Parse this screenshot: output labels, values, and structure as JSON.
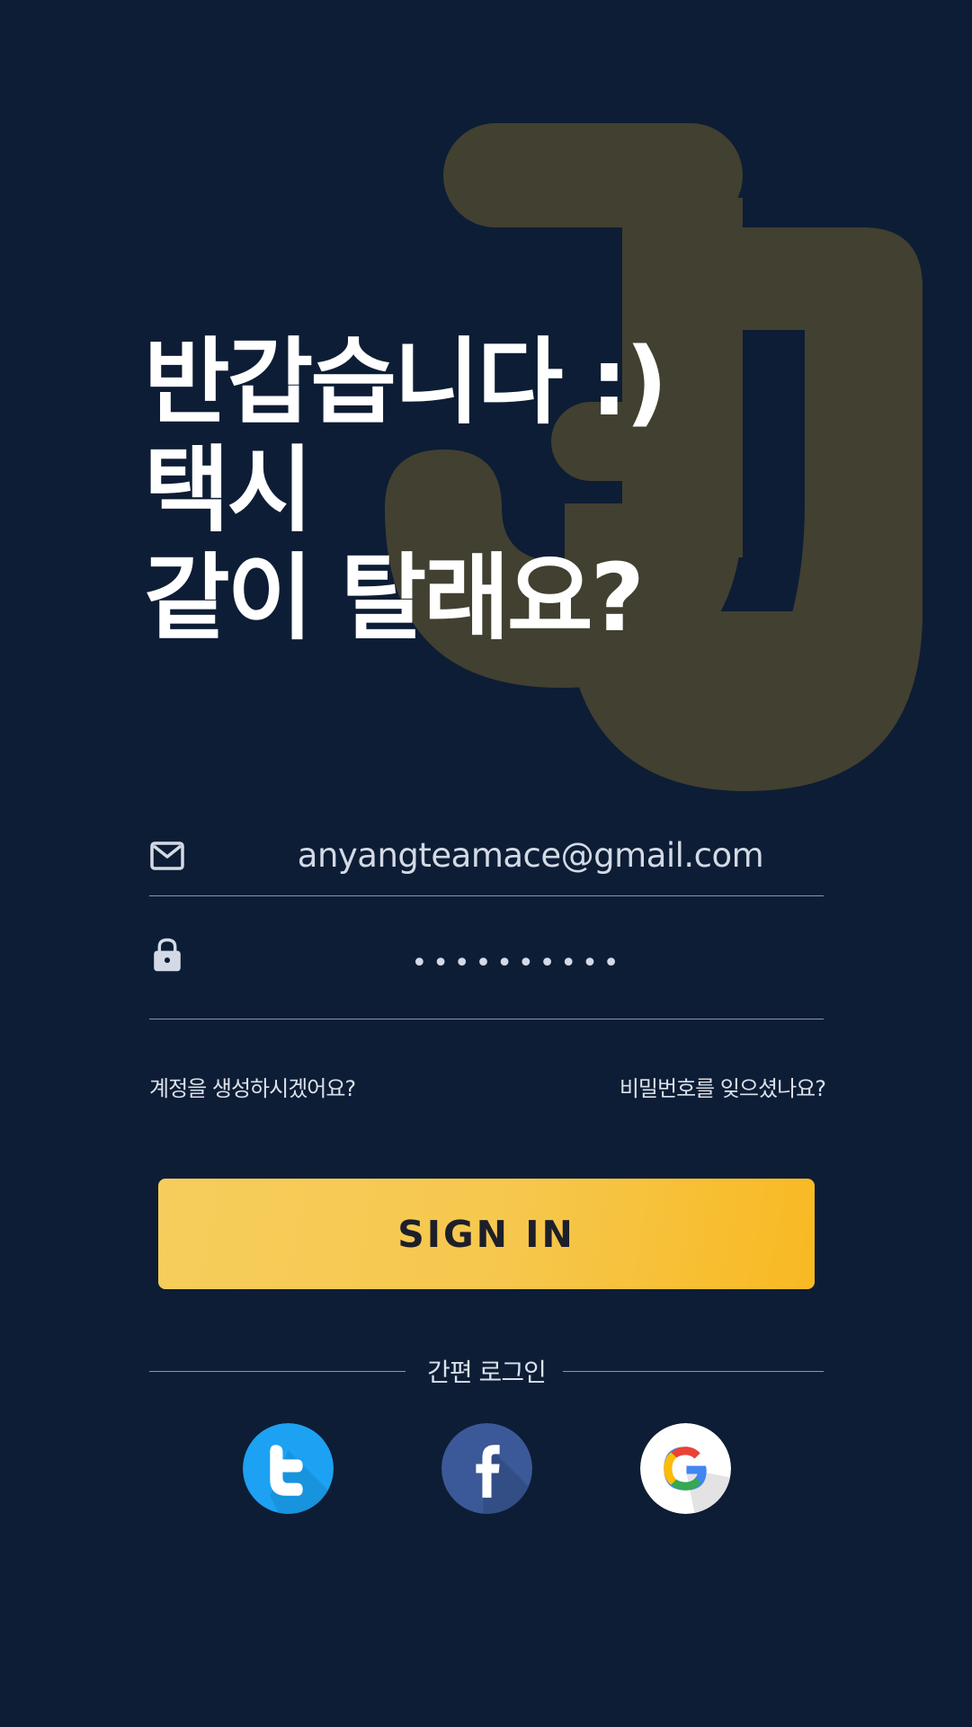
{
  "greeting": {
    "line1": "반갑습니다 :)",
    "line2": "택시",
    "line3": "같이 탈래요?"
  },
  "login_form": {
    "email_value": "anyangteamace@gmail.com",
    "email_icon": "mail-icon",
    "password_value": "••••••••••",
    "password_icon": "lock-icon"
  },
  "links": {
    "create_account": "계정을 생성하시겠어요?",
    "forgot_password": "비밀번호를 잊으셨나요?"
  },
  "signin_button": {
    "label": "SIGN IN"
  },
  "social_login": {
    "label": "간편 로그인",
    "providers": [
      "twitter",
      "facebook",
      "google"
    ]
  },
  "colors": {
    "background": "#0d1d35",
    "accent": "#f7c548",
    "logo_overlay": "#4a4530",
    "twitter": "#1da1f2",
    "facebook": "#3b5998"
  }
}
